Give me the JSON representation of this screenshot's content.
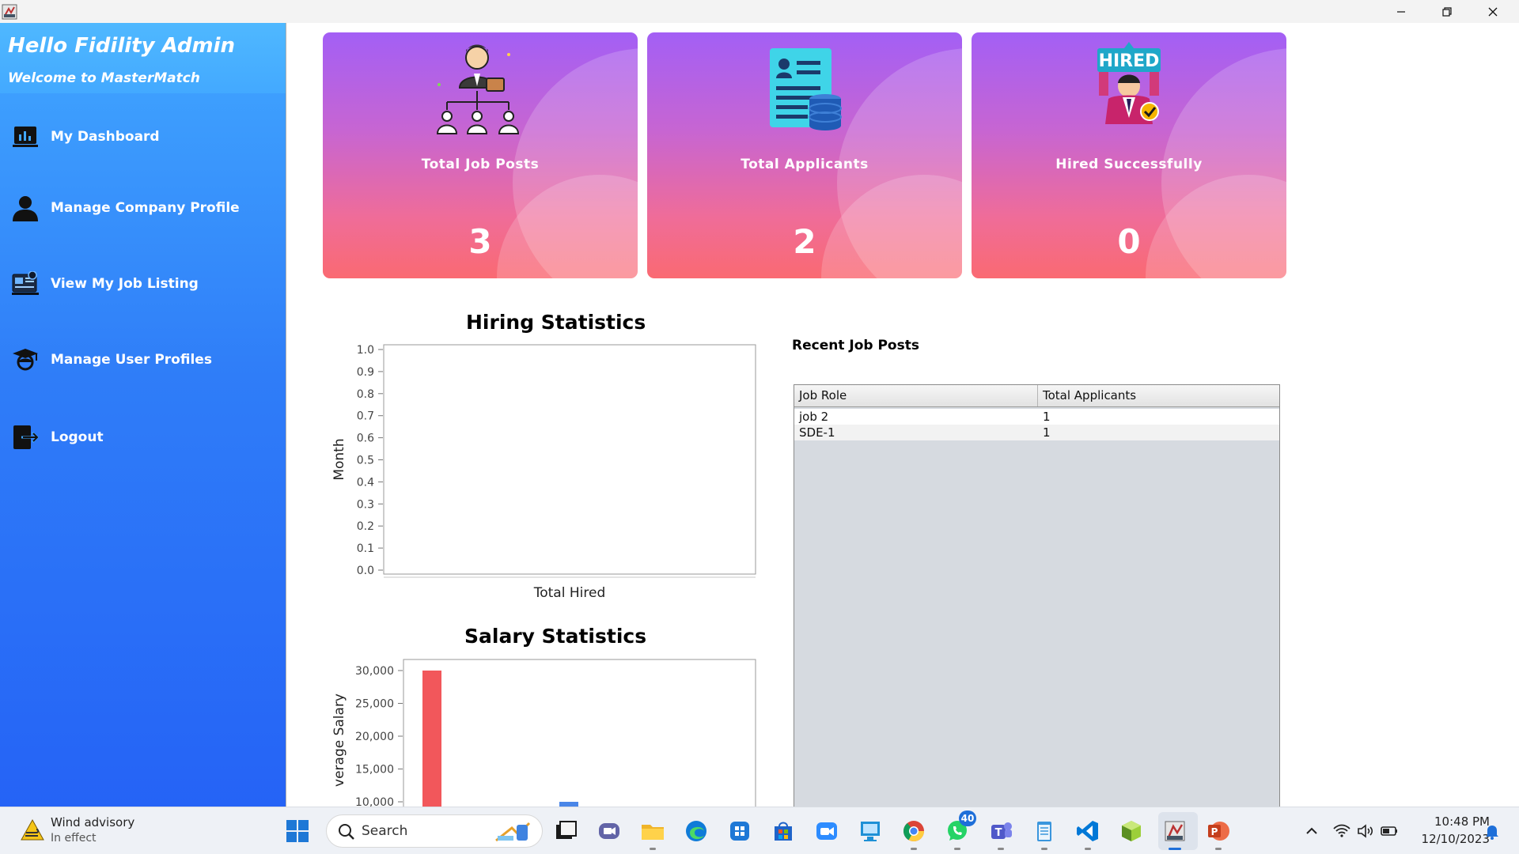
{
  "sidebar": {
    "greeting": "Hello Fidility Admin",
    "welcome": "Welcome to MasterMatch",
    "items": [
      {
        "label": "My Dashboard",
        "icon": "dashboard-chart-icon"
      },
      {
        "label": "Manage Company Profile",
        "icon": "user-icon"
      },
      {
        "label": "View My Job Listing",
        "icon": "job-listing-icon"
      },
      {
        "label": "Manage User Profiles",
        "icon": "graduate-icon"
      },
      {
        "label": "Logout",
        "icon": "logout-icon"
      }
    ]
  },
  "cards": [
    {
      "label": "Total Job Posts",
      "value": "3",
      "icon": "org-chart-icon"
    },
    {
      "label": "Total Applicants",
      "value": "2",
      "icon": "resume-database-icon"
    },
    {
      "label": "Hired Successfully",
      "value": "0",
      "icon": "hired-icon",
      "icon_text": "HIRED"
    }
  ],
  "chart_data": [
    {
      "type": "bar",
      "title": "Hiring Statistics",
      "xlabel": "Total Hired",
      "ylabel": "Month",
      "ylim": [
        0,
        1.0
      ],
      "yticks": [
        "0.0",
        "0.1",
        "0.2",
        "0.3",
        "0.4",
        "0.5",
        "0.6",
        "0.7",
        "0.8",
        "0.9",
        "1.0"
      ],
      "categories": [],
      "values": []
    },
    {
      "type": "bar",
      "title": "Salary Statistics",
      "ylabel": "verage Salary",
      "ylim": [
        10000,
        30000
      ],
      "yticks": [
        "10,000",
        "15,000",
        "20,000",
        "25,000",
        "30,000"
      ],
      "series": [
        {
          "values": [
            30000
          ],
          "color": "#f2575b"
        },
        {
          "values": [
            10000
          ],
          "color": "#4a86e8"
        }
      ]
    }
  ],
  "recent_jobs": {
    "title": "Recent Job Posts",
    "columns": [
      "Job Role",
      "Total Applicants"
    ],
    "rows": [
      [
        "job 2",
        "1"
      ],
      [
        "SDE-1",
        "1"
      ]
    ]
  },
  "taskbar": {
    "weather_title": "Wind advisory",
    "weather_sub": "In effect",
    "search_placeholder": "Search",
    "whatsapp_badge": "40",
    "time": "10:48 PM",
    "date": "12/10/2023"
  },
  "colors": {
    "sidebar_top": "#41a7ff",
    "sidebar_bottom": "#2563f6",
    "card_top": "#a35ff5",
    "card_bottom": "#fa6a72",
    "bar_red": "#f2575b"
  }
}
